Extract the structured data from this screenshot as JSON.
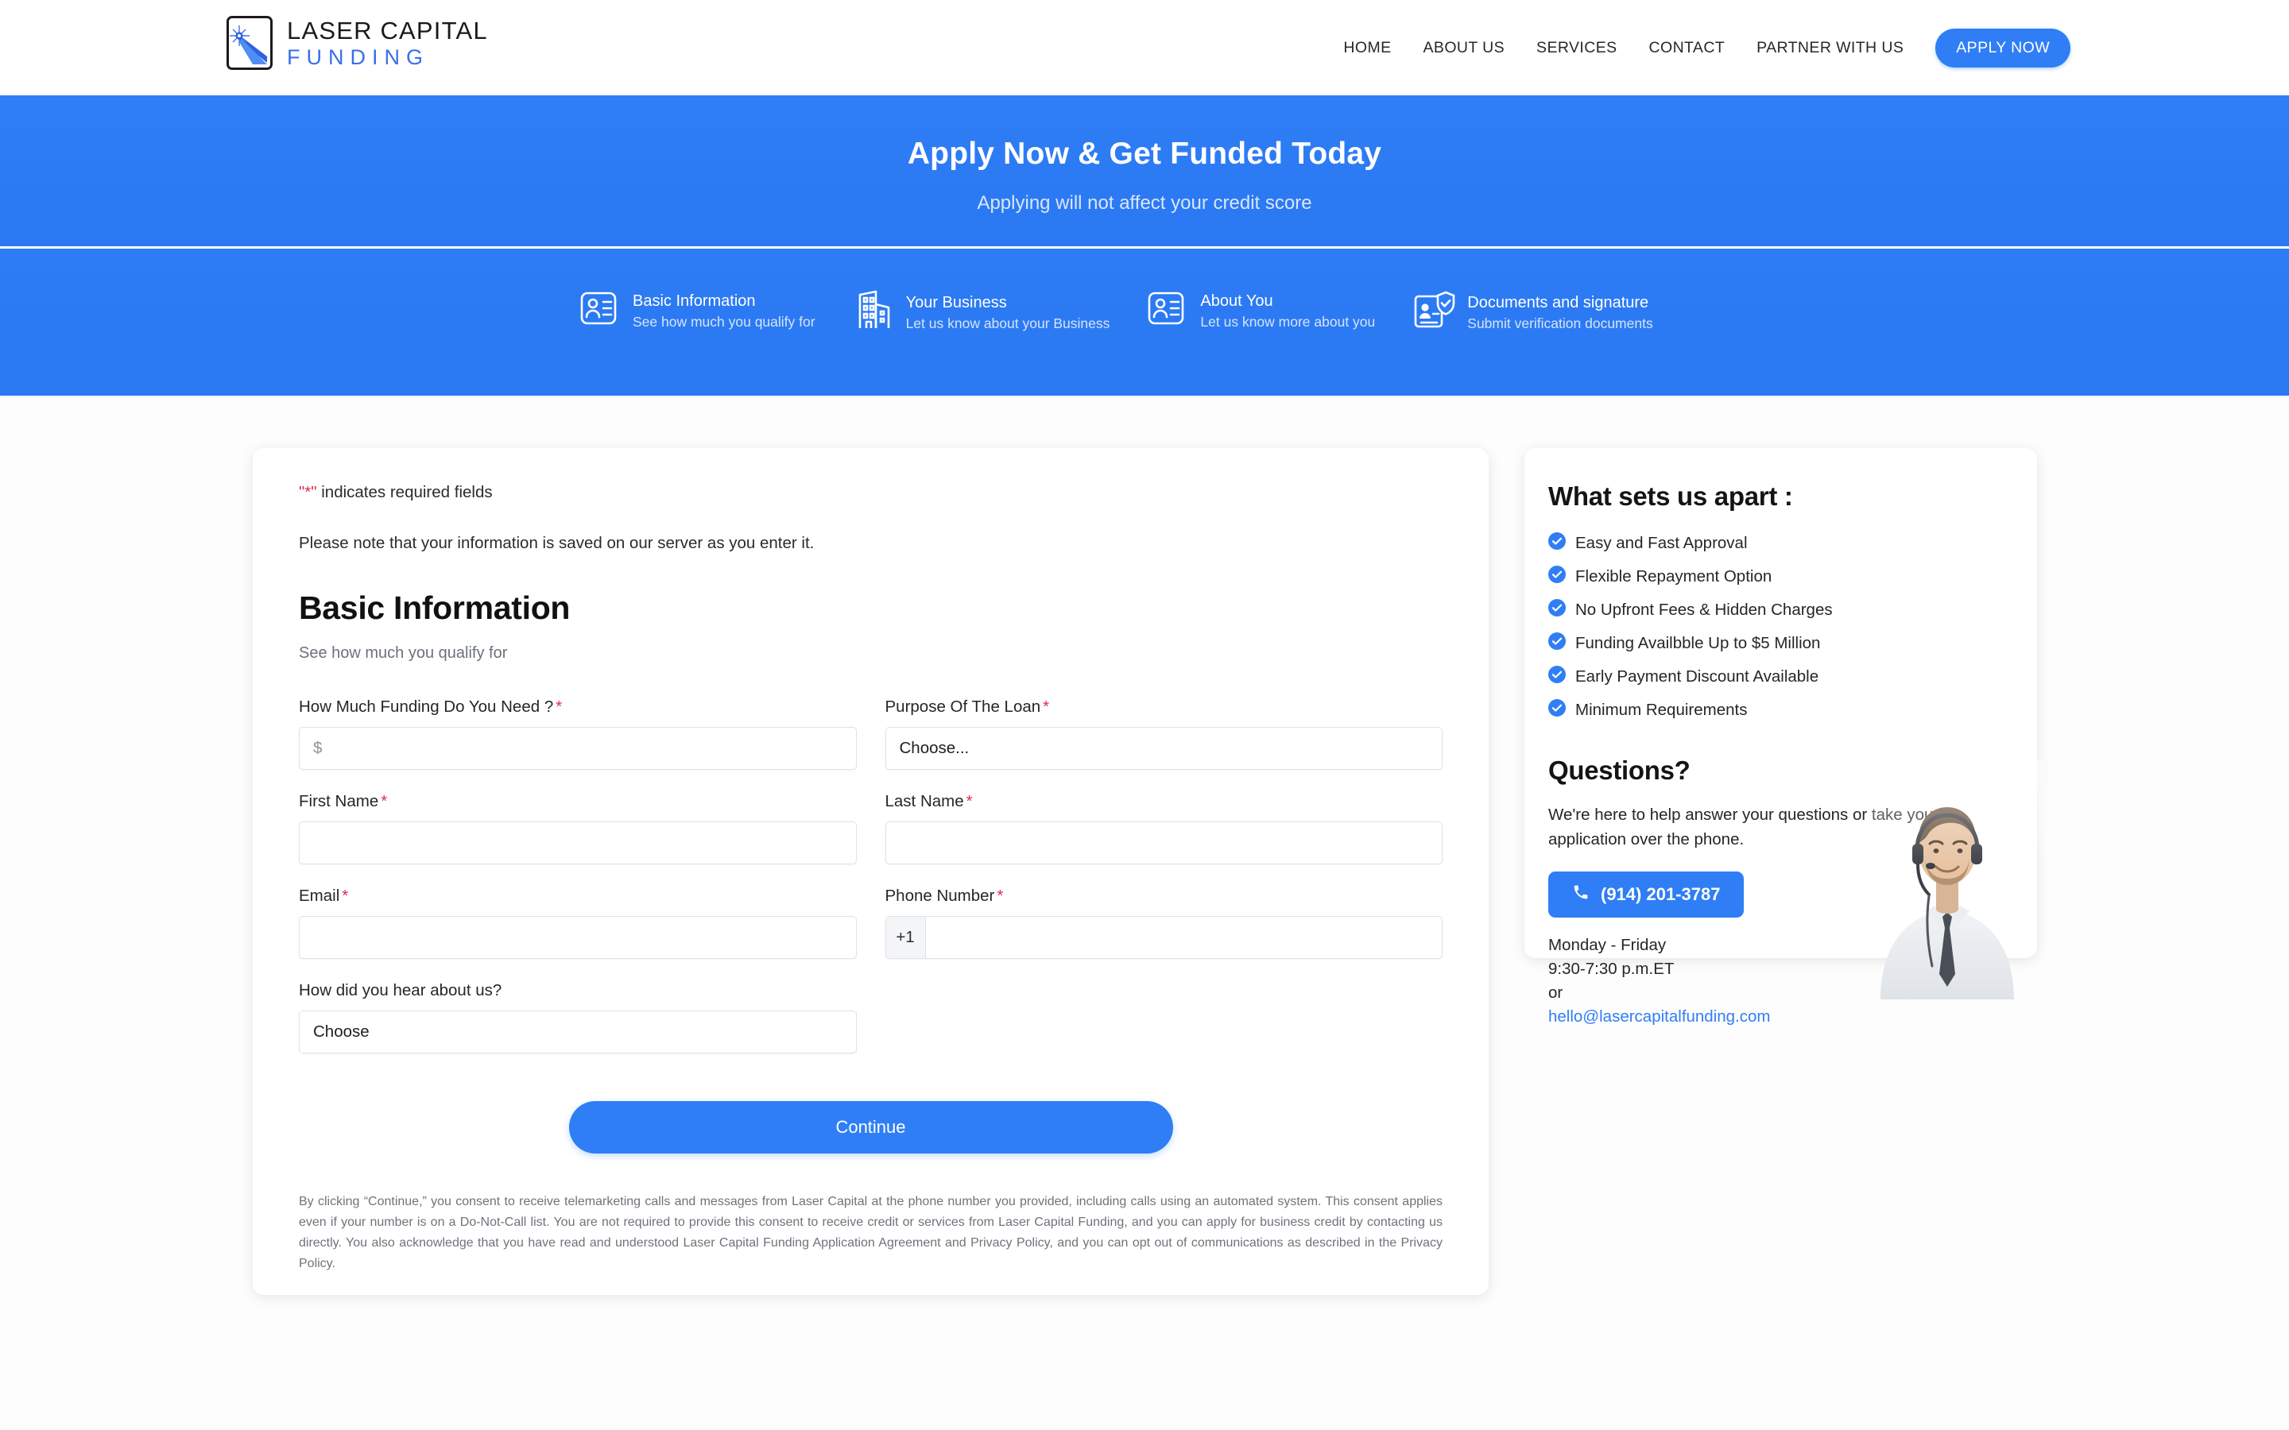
{
  "header": {
    "logo": {
      "line1": "LASER CAPITAL",
      "line2": "FUNDING"
    },
    "nav": [
      {
        "label": "HOME"
      },
      {
        "label": "ABOUT US"
      },
      {
        "label": "SERVICES"
      },
      {
        "label": "CONTACT"
      },
      {
        "label": "PARTNER WITH US"
      }
    ],
    "apply_label": "APPLY NOW"
  },
  "hero": {
    "title": "Apply Now & Get Funded Today",
    "subtitle": "Applying will not affect your credit score"
  },
  "steps": [
    {
      "icon": "id-card-icon",
      "title": "Basic Information",
      "desc": "See how much you qualify for"
    },
    {
      "icon": "buildings-icon",
      "title": "Your Business",
      "desc": "Let us know about your Business"
    },
    {
      "icon": "id-card-icon",
      "title": "About You",
      "desc": "Let us know more about you"
    },
    {
      "icon": "document-shield-check-icon",
      "title": "Documents and signature",
      "desc": "Submit verification documents"
    }
  ],
  "form": {
    "required_prefix": "\"*\"",
    "required_note": " indicates required fields",
    "save_note": "Please note that your information is saved on our server as you enter it.",
    "heading": "Basic Information",
    "subheading": "See how much you qualify for",
    "fields": {
      "funding_amount": {
        "label": "How Much Funding Do You Need ?",
        "required": "*",
        "placeholder": "$",
        "value": ""
      },
      "loan_purpose": {
        "label": "Purpose Of The Loan",
        "required": "*",
        "value": "Choose..."
      },
      "first_name": {
        "label": "First Name",
        "required": "*",
        "placeholder": "",
        "value": ""
      },
      "last_name": {
        "label": "Last Name",
        "required": "*",
        "placeholder": "",
        "value": ""
      },
      "email": {
        "label": "Email",
        "required": "*",
        "placeholder": "",
        "value": ""
      },
      "phone": {
        "label": "Phone Number",
        "required": "*",
        "country_code": "+1",
        "placeholder": "",
        "value": ""
      },
      "hear_about": {
        "label": "How did you hear about us?",
        "required": "",
        "value": "Choose"
      }
    },
    "continue_label": "Continue",
    "disclaimer": "By clicking “Continue,” you consent to receive telemarketing calls and messages from Laser Capital at the phone number you provided, including calls using an automated system. This consent applies even if your number is on a Do-Not-Call list. You are not required to provide this consent to receive credit or services from Laser Capital Funding, and you can apply for business credit by contacting us directly. You also acknowledge that you have read and understood Laser Capital Funding Application Agreement and Privacy Policy, and you can opt out of communications as described in the Privacy Policy."
  },
  "sidebar": {
    "apart_heading": "What sets us apart :",
    "features": [
      {
        "label": "Easy and Fast Approval"
      },
      {
        "label": "Flexible Repayment Option"
      },
      {
        "label": "No Upfront Fees & Hidden Charges"
      },
      {
        "label": "Funding Availbble Up to $5 Million"
      },
      {
        "label": "Early Payment Discount Available"
      },
      {
        "label": "Minimum Requirements"
      }
    ],
    "questions_heading": "Questions?",
    "questions_text": "We're here to help answer your questions or take your application over the phone.",
    "phone": "(914) 201-3787",
    "hours_days": "Monday - Friday",
    "hours_time": "9:30-7:30 p.m.ET",
    "or_label": "or",
    "email": "hello@lasercapitalfunding.com"
  },
  "colors": {
    "brand_blue": "#2f7ef5",
    "logo_blue": "#3a6fe8",
    "required_red": "#e02b4a",
    "banner_sub": "#d9e6fd"
  }
}
